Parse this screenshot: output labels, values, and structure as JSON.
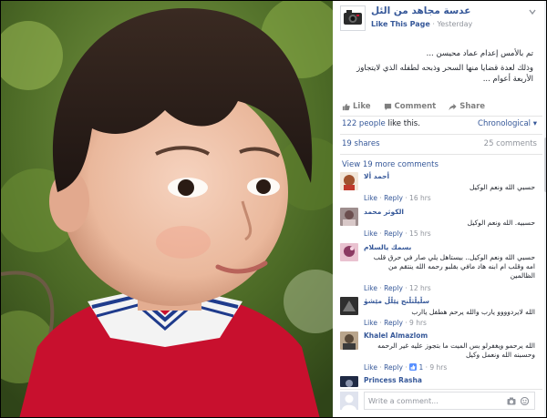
{
  "post": {
    "page_name": "عدسة مجاهد من الئل",
    "like_page_label": "Like This Page",
    "separator": "·",
    "time": "Yesterday",
    "text": [
      "تم بالأمس إعدام عماد محيسن ...",
      "وذلك لعدة قضايا منها السحر وذبحه لطفله الذي لايتجاوز الأربعة أعوام ..."
    ]
  },
  "actions": {
    "like": "Like",
    "comment": "Comment",
    "share": "Share"
  },
  "stats": {
    "likes_count": "122 people",
    "likes_suffix": " like this.",
    "order": "Chronological",
    "shares": "19 shares",
    "comments": "25 comments"
  },
  "more_comments": "View 19 more comments",
  "comments": [
    {
      "name": "أحمد ألا",
      "text": "حسبي الله ونعم الوكيل",
      "like": "Like",
      "reply": "Reply",
      "time": "16 hrs",
      "avatar_color": "#a0522d"
    },
    {
      "name": "الكوثر محمد",
      "text": "حسبيه. الله ونعم الوكيل",
      "like": "Like",
      "reply": "Reply",
      "time": "15 hrs",
      "avatar_color": "#6b4f4f"
    },
    {
      "name": "بسمك يالسلام",
      "text": "حسبي الله ونعم الوكيل.. بيستاهل يلي صار في حرق قلب امه وقلب ام ابنه هاد مافي بقلبو رحمه الله ينتقم من الظالمين",
      "like": "Like",
      "reply": "Reply",
      "time": "12 hrs",
      "avatar_color": "#8b3a62"
    },
    {
      "name": "سڵيڵثڵنج ڼێڵڵ مێشۈ",
      "text": "الله لايردوووو يارب والله يرحم هطفل ياارب",
      "like": "Like",
      "reply": "Reply",
      "time": "9 hrs",
      "avatar_color": "#2f2f2f"
    },
    {
      "name": "Khalel Almazlom",
      "text": "الله يرحمو ويغفرلو بس الميت ما بتجوز عليه غير الرحمه وحسبنه الله ونعمل وكيل",
      "like": "Like",
      "reply": "Reply",
      "likes": "1",
      "time": "9 hrs",
      "avatar_color": "#5a4a3a"
    },
    {
      "name": "Princess Rasha",
      "avatar_color": "#1f2a44"
    }
  ],
  "write_comment": {
    "placeholder": "Write a comment..."
  },
  "icons": [
    "page-logo-icon",
    "chevron-down-icon",
    "like-icon",
    "comment-icon",
    "share-icon",
    "camera-icon",
    "sticker-icon",
    "thumbs-up-icon"
  ],
  "colors": {
    "link": "#365899",
    "muted": "#90949c",
    "text": "#1d2129"
  }
}
